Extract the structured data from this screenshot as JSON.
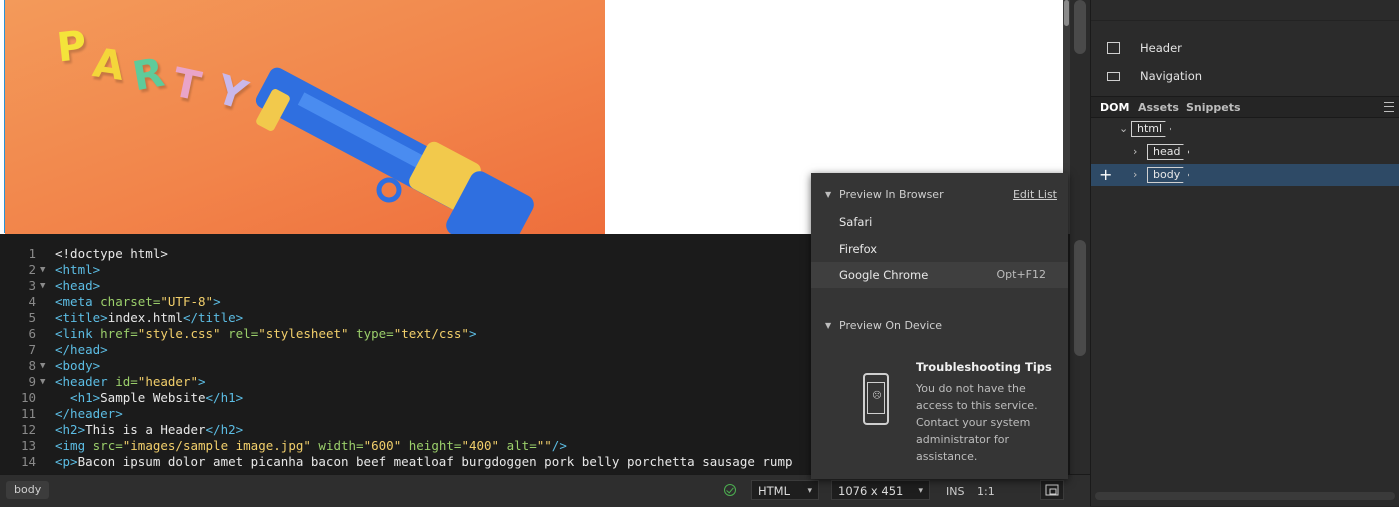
{
  "design_view": {
    "photo_letters": [
      "P",
      "A",
      "R",
      "T",
      "Y"
    ]
  },
  "code": {
    "lines": [
      {
        "n": "1",
        "fold": "",
        "parts": [
          {
            "t": "<!doctype html>",
            "c": "plain"
          }
        ]
      },
      {
        "n": "2",
        "fold": "▼",
        "parts": [
          {
            "t": "<html>",
            "c": "tag"
          }
        ]
      },
      {
        "n": "3",
        "fold": "▼",
        "parts": [
          {
            "t": "<head>",
            "c": "tag"
          }
        ]
      },
      {
        "n": "4",
        "fold": "",
        "parts": [
          {
            "t": "<meta ",
            "c": "tag"
          },
          {
            "t": "charset=",
            "c": "attr"
          },
          {
            "t": "\"UTF-8\"",
            "c": "val"
          },
          {
            "t": ">",
            "c": "tag"
          }
        ]
      },
      {
        "n": "5",
        "fold": "",
        "parts": [
          {
            "t": "<title>",
            "c": "tag"
          },
          {
            "t": "index.html",
            "c": "plain"
          },
          {
            "t": "</title>",
            "c": "tag"
          }
        ]
      },
      {
        "n": "6",
        "fold": "",
        "parts": [
          {
            "t": "<link ",
            "c": "tag"
          },
          {
            "t": "href=",
            "c": "attr"
          },
          {
            "t": "\"style.css\"",
            "c": "val"
          },
          {
            "t": " rel=",
            "c": "attr"
          },
          {
            "t": "\"stylesheet\"",
            "c": "val"
          },
          {
            "t": " type=",
            "c": "attr"
          },
          {
            "t": "\"text/css\"",
            "c": "val"
          },
          {
            "t": ">",
            "c": "tag"
          }
        ]
      },
      {
        "n": "7",
        "fold": "",
        "parts": [
          {
            "t": "</head>",
            "c": "tag"
          }
        ]
      },
      {
        "n": "8",
        "fold": "▼",
        "parts": [
          {
            "t": "<body>",
            "c": "tag"
          }
        ]
      },
      {
        "n": "9",
        "fold": "▼",
        "parts": [
          {
            "t": "<header ",
            "c": "tag"
          },
          {
            "t": "id=",
            "c": "attr"
          },
          {
            "t": "\"header\"",
            "c": "val"
          },
          {
            "t": ">",
            "c": "tag"
          }
        ]
      },
      {
        "n": "10",
        "fold": "",
        "parts": [
          {
            "t": "  <h1>",
            "c": "tag"
          },
          {
            "t": "Sample Website",
            "c": "plain"
          },
          {
            "t": "</h1>",
            "c": "tag"
          }
        ]
      },
      {
        "n": "11",
        "fold": "",
        "parts": [
          {
            "t": "</header>",
            "c": "tag"
          }
        ]
      },
      {
        "n": "12",
        "fold": "",
        "parts": [
          {
            "t": "<h2>",
            "c": "tag"
          },
          {
            "t": "This is a Header",
            "c": "plain"
          },
          {
            "t": "</h2>",
            "c": "tag"
          }
        ]
      },
      {
        "n": "13",
        "fold": "",
        "parts": [
          {
            "t": "<img ",
            "c": "tag"
          },
          {
            "t": "src=",
            "c": "attr"
          },
          {
            "t": "\"images/sample image.jpg\"",
            "c": "val"
          },
          {
            "t": " width=",
            "c": "attr"
          },
          {
            "t": "\"600\"",
            "c": "val"
          },
          {
            "t": " height=",
            "c": "attr"
          },
          {
            "t": "\"400\"",
            "c": "val"
          },
          {
            "t": " alt=",
            "c": "attr"
          },
          {
            "t": "\"\"",
            "c": "val"
          },
          {
            "t": "/>",
            "c": "tag"
          }
        ]
      },
      {
        "n": "14",
        "fold": "",
        "parts": [
          {
            "t": "<p>",
            "c": "tag"
          },
          {
            "t": "Bacon ipsum dolor amet picanha bacon beef meatloaf burgdoggen pork belly porchetta sausage rump",
            "c": "plain"
          }
        ]
      }
    ]
  },
  "status_bar": {
    "breadcrumb": "body",
    "language": "HTML",
    "size": "1076 x 451",
    "mode": "INS",
    "position": "1:1"
  },
  "insert_panel": {
    "items": [
      "Header",
      "Navigation"
    ]
  },
  "panel_tabs": [
    "DOM",
    "Assets",
    "Snippets"
  ],
  "dom_tree": [
    "html",
    "head",
    "body"
  ],
  "preview_popup": {
    "browser_section": "Preview In Browser",
    "edit_list": "Edit List",
    "browsers": [
      {
        "name": "Safari",
        "shortcut": ""
      },
      {
        "name": "Firefox",
        "shortcut": ""
      },
      {
        "name": "Google Chrome",
        "shortcut": "Opt+F12"
      }
    ],
    "device_section": "Preview On Device",
    "tips_title": "Troubleshooting Tips",
    "tips_lines": [
      "You do not have the",
      "access to this service.",
      "Contact your system",
      "administrator for",
      "assistance."
    ]
  }
}
